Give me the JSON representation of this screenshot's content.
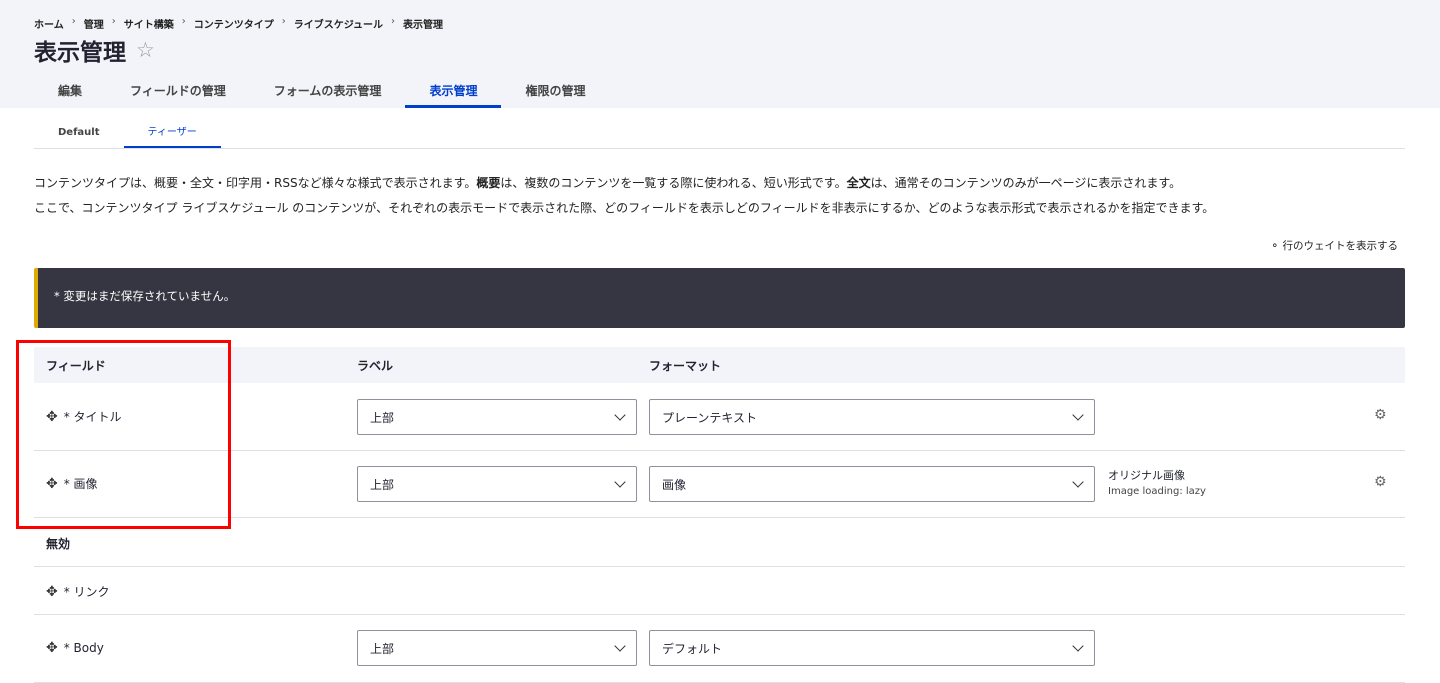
{
  "breadcrumb": [
    "ホーム",
    "管理",
    "サイト構築",
    "コンテンツタイプ",
    "ライブスケジュール",
    "表示管理"
  ],
  "page_title": "表示管理",
  "tabs": [
    {
      "label": "編集"
    },
    {
      "label": "フィールドの管理"
    },
    {
      "label": "フォームの表示管理"
    },
    {
      "label": "表示管理",
      "active": true
    },
    {
      "label": "権限の管理"
    }
  ],
  "subtabs": [
    {
      "label": "Default"
    },
    {
      "label": "ティーザー",
      "active": true
    }
  ],
  "description": {
    "line1_a": "コンテンツタイプは、概要・全文・印字用・RSSなど様々な様式で表示されます。",
    "line1_b": "概要",
    "line1_c": "は、複数のコンテンツを一覧する際に使われる、短い形式です。",
    "line1_d": "全文",
    "line1_e": "は、通常そのコンテンツのみが一ページに表示されます。",
    "line2": "ここで、コンテンツタイプ ライブスケジュール のコンテンツが、それぞれの表示モードで表示された際、どのフィールドを表示しどのフィールドを非表示にするか、どのような表示形式で表示されるかを指定できます。"
  },
  "show_weights": "行のウェイトを表示する",
  "message": "* 変更はまだ保存されていません。",
  "table": {
    "headers": {
      "field": "フィールド",
      "label": "ラベル",
      "format": "フォーマット"
    },
    "rows": [
      {
        "field": "* タイトル",
        "label": "上部",
        "format": "プレーンテキスト"
      },
      {
        "field": "* 画像",
        "label": "上部",
        "format": "画像",
        "summary": [
          "オリジナル画像",
          "Image loading: lazy"
        ]
      }
    ],
    "disabled_label": "無効",
    "disabled_rows": [
      {
        "field": "* リンク"
      },
      {
        "field": "* Body",
        "label": "上部",
        "format": "デフォルト"
      }
    ]
  },
  "colors": {
    "accent": "#003ecc",
    "highlight": "#ff0000",
    "message_bg": "#353641"
  }
}
